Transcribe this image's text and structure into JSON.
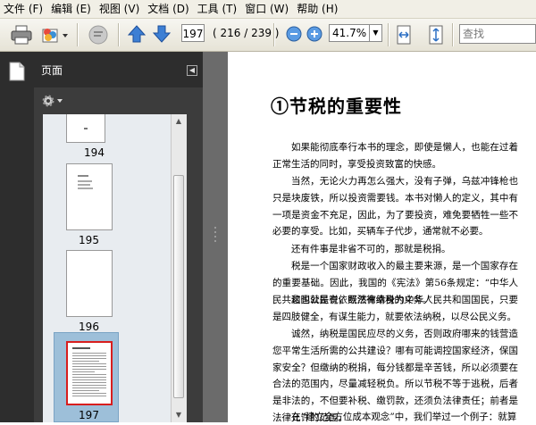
{
  "menu": {
    "items": [
      "文件 (F)",
      "编辑 (E)",
      "视图 (V)",
      "文档 (D)",
      "工具 (T)",
      "窗口 (W)",
      "帮助 (H)"
    ]
  },
  "toolbar": {
    "current_page": "197",
    "page_count": "( 216 / 239 )",
    "zoom": "41.7%",
    "search_placeholder": "查找"
  },
  "pages_panel": {
    "title": "页面",
    "thumbnails": [
      {
        "number": "194",
        "selected": false
      },
      {
        "number": "195",
        "selected": false
      },
      {
        "number": "196",
        "selected": false
      },
      {
        "number": "197",
        "selected": true
      }
    ]
  },
  "document": {
    "title": "①节税的重要性",
    "paragraphs": [
      "如果能彻底奉行本书的理念，即使是懒人，也能在过着正常生活的同时，享受投资致富的快感。",
      "当然，无论火力再怎么强大，没有子弹，乌兹冲锋枪也只是块废铁，所以投资需要钱。本书对懒人的定义，其中有一项是资金不充足，因此，为了要投资，难免要牺牲一些不必要的享受。比如，买辆车子代步，通常就不必要。",
      "还有件事是非省不可的，那就是税捐。",
      "税是一个国家财政收入的最主要来源，是一个国家存在的重要基础。因此，我国的《宪法》第56条规定：“中华人民共和国公民有依照法律纳税的义务。”",
      "这也就是说，既然有幸身为中华人民共和国国民，只要是四肢健全，有谋生能力，就要依法纳税，以尽公民义务。",
      "诚然，纳税是国民应尽的义务，否则政府哪来的钱营造您平常生活所需的公共建设？哪有可能调控国家经济，保国家安全？但缴纳的税捐，每分钱都是辛苦钱，所以必须要在合法的范围内，尽量减轻税负。所以节税不等于逃税，后者是非法的，不但要补税、缴罚款，还须负法律责任；前者是法律允许的范围。",
      "在“建立全方位成本观念”中，我们举过一个例子：就算"
    ]
  },
  "colors": {
    "menubar_bg": "#f1efe6",
    "panel_dark": "#3c3c3c",
    "selection_blue": "#9dbfd9",
    "selection_frame": "#d81e1e"
  }
}
